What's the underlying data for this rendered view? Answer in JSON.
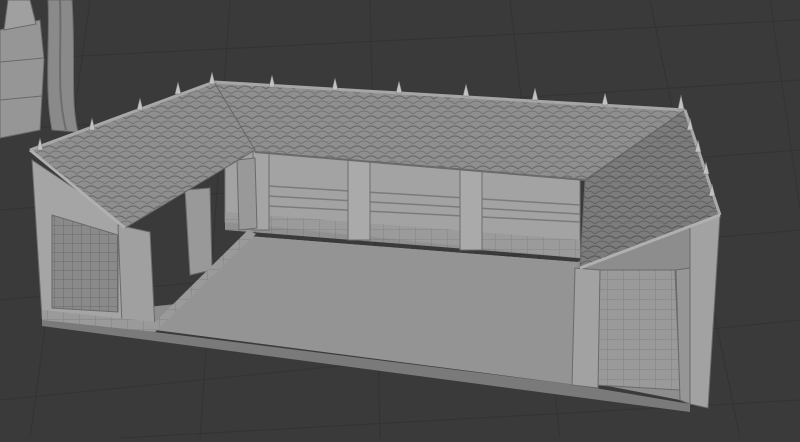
{
  "viewport": {
    "background": "#3a3a3a",
    "grid_color": "#333333"
  },
  "model": {
    "shade_light": "#a7a7a7",
    "shade_mid": "#949494",
    "shade_dark": "#6e6e6e",
    "shade_floor": "#8d8d8d",
    "shade_roof_dark": "#7d7d7d",
    "shade_roof": "#8f8f8f"
  }
}
